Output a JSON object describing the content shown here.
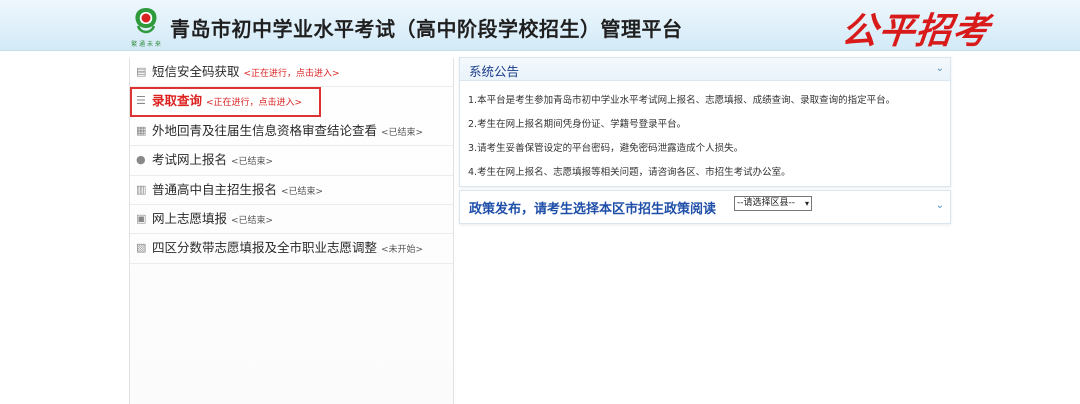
{
  "header": {
    "title": "青岛市初中学业水平考试（高中阶段学校招生）管理平台",
    "logo_caption": "繁 通 未 来",
    "slogan": "公平招考"
  },
  "menu": [
    {
      "icon": "message-icon",
      "label": "短信安全码获取",
      "status": "<正在进行，点击进入>",
      "active": true,
      "highlighted": false
    },
    {
      "icon": "search-icon",
      "label": "录取查询",
      "status": "<正在进行，点击进入>",
      "active": true,
      "highlighted": true
    },
    {
      "icon": "document-icon",
      "label": "外地回青及往届生信息资格审查结论查看",
      "status": "<已结束>",
      "active": false,
      "highlighted": false
    },
    {
      "icon": "user-icon",
      "label": "考试网上报名",
      "status": "<已结束>",
      "active": false,
      "highlighted": false
    },
    {
      "icon": "database-icon",
      "label": "普通高中自主招生报名",
      "status": "<已结束>",
      "active": false,
      "highlighted": false
    },
    {
      "icon": "image-icon",
      "label": "网上志愿填报",
      "status": "<已结束>",
      "active": false,
      "highlighted": false
    },
    {
      "icon": "layers-icon",
      "label": "四区分数带志愿填报及全市职业志愿调整",
      "status": "<未开始>",
      "active": false,
      "highlighted": false
    }
  ],
  "notice": {
    "title": "系统公告",
    "lines": [
      "1.本平台是考生参加青岛市初中学业水平考试网上报名、志愿填报、成绩查询、录取查询的指定平台。",
      "2.考生在网上报名期间凭身份证、学籍号登录平台。",
      "3.请考生妥善保管设定的平台密码，避免密码泄露造成个人损失。",
      "4.考生在网上报名、志愿填报等相关问题，请咨询各区、市招生考试办公室。"
    ]
  },
  "policy": {
    "title": "政策发布，请考生选择本区市招生政策阅读",
    "select_value": "--请选择区县--"
  },
  "colors": {
    "accent_red": "#d22222",
    "title_blue": "#1f4fa8",
    "header_bg": "#dff0fa"
  }
}
